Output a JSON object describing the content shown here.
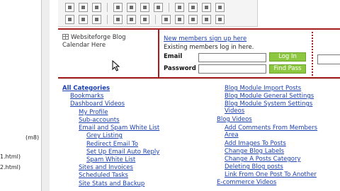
{
  "left_panel": {
    "fragments": [
      "(m8)",
      "1.html)",
      "2.html)"
    ]
  },
  "toolbar": {
    "row1_icons": [
      "align-left-icon",
      "align-center-icon",
      "align-right-icon",
      "justify-icon",
      "list-icon",
      "indent-icon",
      "outdent-icon",
      "format-icon",
      "table-icon",
      "image-icon",
      "link-icon"
    ],
    "row2_icons": [
      "table-insert-icon",
      "table-row-icon",
      "table-col-icon",
      "cell-icon",
      "merge-icon",
      "split-icon",
      "copy-icon",
      "paste-icon",
      "cut-icon",
      "undo-icon",
      "redo-icon"
    ]
  },
  "calendar": {
    "text": "Websiteforge Blog Calendar Here"
  },
  "login": {
    "signup_link": "New members sign up here",
    "existing_text": "Existing members log in here.",
    "email_label": "Email",
    "password_label": "Password",
    "login_button": "Log In",
    "find_pass_button": "Find Pass"
  },
  "categories": {
    "left": [
      {
        "label": "All Categories",
        "indent": 0,
        "bold": true
      },
      {
        "label": "Bookmarks",
        "indent": 1
      },
      {
        "label": "Dashboard Videos",
        "indent": 1
      },
      {
        "label": "My Profile",
        "indent": 2
      },
      {
        "label": "Sub-accounts",
        "indent": 2
      },
      {
        "label": "Email and Spam White List",
        "indent": 2
      },
      {
        "label": "Grey Listing",
        "indent": 3
      },
      {
        "label": "Redirect Email To",
        "indent": 3
      },
      {
        "label": "Set Up Email Auto Reply",
        "indent": 3
      },
      {
        "label": "Spam White List",
        "indent": 3
      },
      {
        "label": "Sites and Invoices",
        "indent": 2
      },
      {
        "label": "Scheduled Tasks",
        "indent": 2
      },
      {
        "label": "Site Stats and Backup",
        "indent": 2
      }
    ],
    "right": [
      {
        "label": "Blog Module Import Posts",
        "indent": 1
      },
      {
        "label": "Blog Module General Settings",
        "indent": 1
      },
      {
        "label": "Blog Module System Settings Videos",
        "indent": 1,
        "wrap": true
      },
      {
        "label": "Blog Videos",
        "indent": 0
      },
      {
        "label": "Add Comments From Members Area",
        "indent": 1,
        "wrap": true
      },
      {
        "label": "Add Images To Posts",
        "indent": 1
      },
      {
        "label": "Change Blog Labels",
        "indent": 1
      },
      {
        "label": "Change A Posts Category",
        "indent": 1
      },
      {
        "label": "Deleting Blog posts",
        "indent": 1
      },
      {
        "label": "Link From One Post To Another",
        "indent": 1
      },
      {
        "label": "E-commerce Videos",
        "indent": 0
      }
    ]
  },
  "colors": {
    "border_red": "#a31d1d",
    "link_blue": "#1a3fb0",
    "button_green": "#8dc63f"
  }
}
